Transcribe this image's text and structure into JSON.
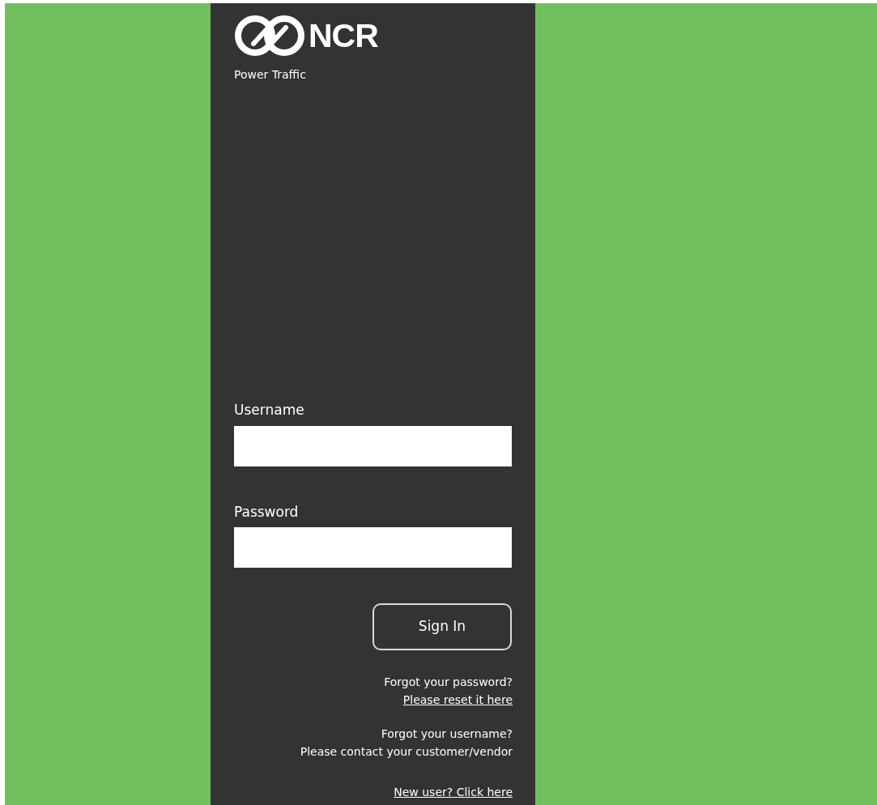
{
  "logo": {
    "wordmark": "NCR",
    "product": "Power Traffic"
  },
  "fields": [
    {
      "label": "Username"
    },
    {
      "label": "Password"
    }
  ],
  "sign_in_button": "Sign In",
  "help": [
    {
      "text": "Forgot your password?",
      "link": "Please reset it here"
    },
    {
      "text": "Forgot your username?",
      "note": "Please contact your customer/vendor"
    }
  ],
  "new_user_link": "New user? Click here"
}
